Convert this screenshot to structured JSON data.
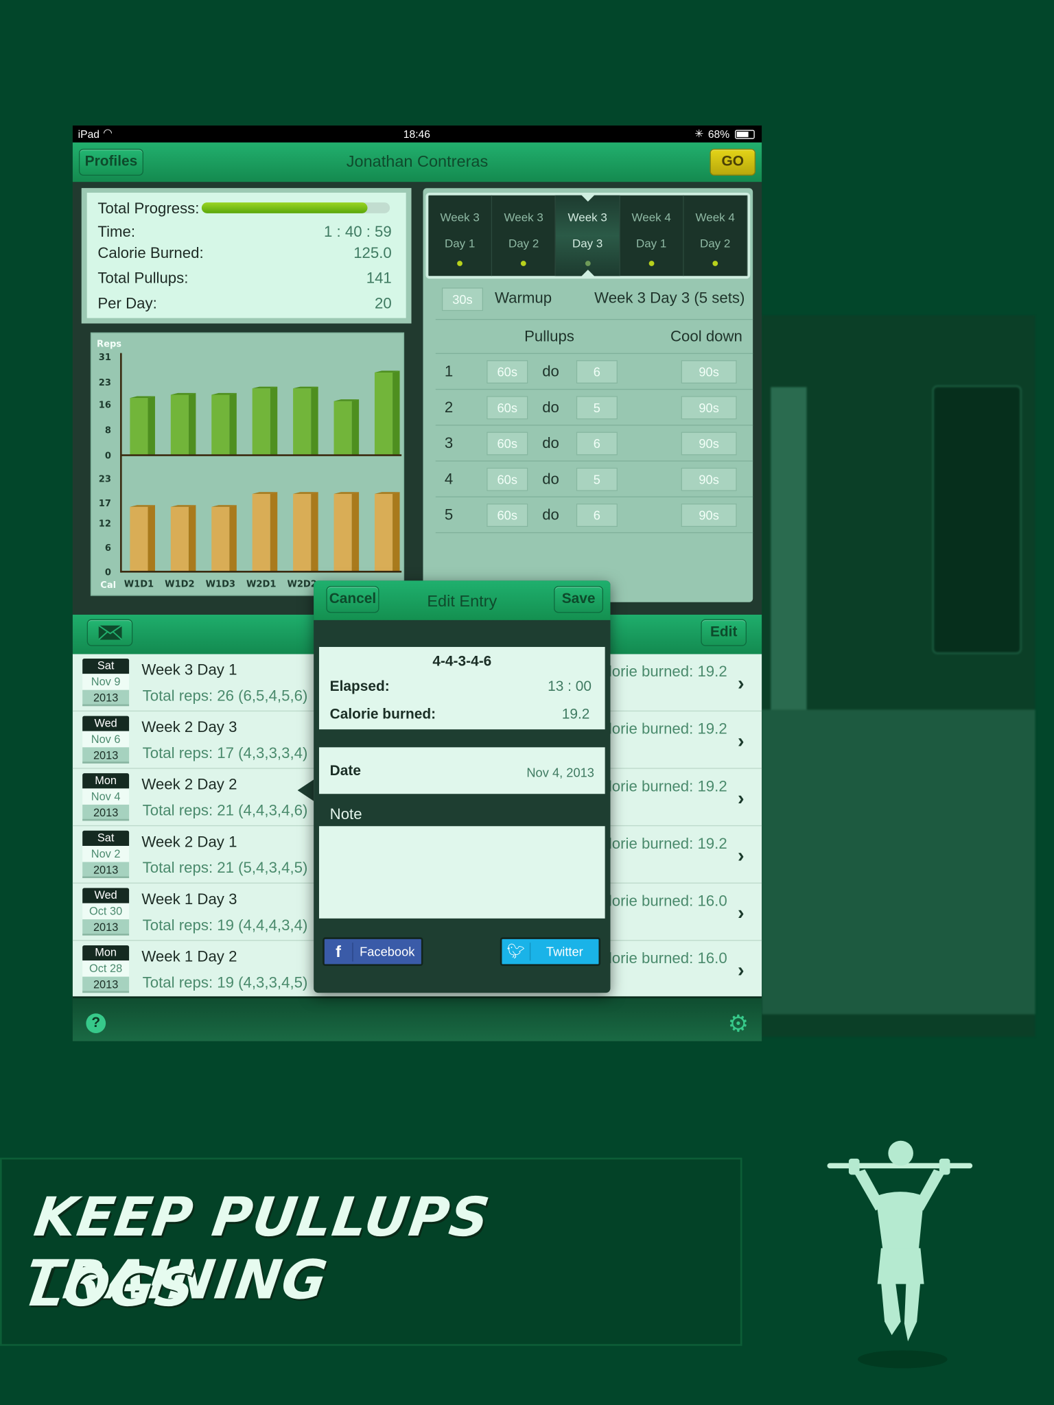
{
  "status_bar": {
    "device": "iPad",
    "time": "18:46",
    "battery": "68%"
  },
  "nav": {
    "profiles_label": "Profiles",
    "title": "Jonathan Contreras",
    "go_label": "GO"
  },
  "stats": {
    "progress_label": "Total Progress:",
    "progress_percent": 88,
    "rows": [
      {
        "label": "Time:",
        "value": "1 : 40 : 59"
      },
      {
        "label": "Calorie Burned:",
        "value": "125.0"
      },
      {
        "label": "Total Pullups:",
        "value": "141"
      },
      {
        "label": "Per Day:",
        "value": "20"
      }
    ]
  },
  "chart_data": {
    "type": "bar",
    "categories": [
      "W1D1",
      "W1D2",
      "W1D3",
      "W2D1",
      "W2D2",
      "",
      ""
    ],
    "series": [
      {
        "name": "Reps",
        "values": [
          18,
          19,
          19,
          21,
          21,
          17,
          26
        ],
        "color": "#72b53a",
        "yticks": [
          0,
          8,
          16,
          23,
          31
        ],
        "ylim": [
          0,
          31
        ]
      },
      {
        "name": "Cal",
        "values": [
          16,
          16,
          16,
          19.2,
          19.2,
          19.2,
          19.2
        ],
        "color": "#d9ad56",
        "yticks": [
          0,
          6,
          12,
          17,
          23
        ],
        "ylim": [
          0,
          23
        ]
      }
    ]
  },
  "weeks": [
    {
      "l1": "Week 3",
      "l2": "Day 1"
    },
    {
      "l1": "Week 3",
      "l2": "Day 2"
    },
    {
      "l1": "Week 3",
      "l2": "Day 3",
      "selected": true
    },
    {
      "l1": "Week 4",
      "l2": "Day 1"
    },
    {
      "l1": "Week 4",
      "l2": "Day 2"
    }
  ],
  "workout": {
    "warmup_time": "30s",
    "warmup_label": "Warmup",
    "plan_title": "Week 3 Day 3 (5 sets)",
    "col_pullups": "Pullups",
    "col_cooldown": "Cool down",
    "sets": [
      {
        "n": "1",
        "rest": "60s",
        "do": "do",
        "reps": "6",
        "cool": "90s"
      },
      {
        "n": "2",
        "rest": "60s",
        "do": "do",
        "reps": "5",
        "cool": "90s"
      },
      {
        "n": "3",
        "rest": "60s",
        "do": "do",
        "reps": "6",
        "cool": "90s"
      },
      {
        "n": "4",
        "rest": "60s",
        "do": "do",
        "reps": "5",
        "cool": "90s"
      },
      {
        "n": "5",
        "rest": "60s",
        "do": "do",
        "reps": "6",
        "cool": "90s"
      }
    ]
  },
  "toolbar": {
    "edit_label": "Edit"
  },
  "log": [
    {
      "dow": "Sat",
      "md": "Nov 9",
      "year": "2013",
      "title": "Week 3 Day 1",
      "reps": "Total reps: 26 (6,5,4,5,6)",
      "cal": "lorie burned: 19.2"
    },
    {
      "dow": "Wed",
      "md": "Nov 6",
      "year": "2013",
      "title": "Week 2 Day 3",
      "reps": "Total reps: 17 (4,3,3,3,4)",
      "cal": "lorie burned: 19.2"
    },
    {
      "dow": "Mon",
      "md": "Nov 4",
      "year": "2013",
      "title": "Week 2 Day 2",
      "reps": "Total reps: 21 (4,4,3,4,6)",
      "cal": "lorie burned: 19.2"
    },
    {
      "dow": "Sat",
      "md": "Nov 2",
      "year": "2013",
      "title": "Week 2 Day 1",
      "reps": "Total reps: 21 (5,4,3,4,5)",
      "cal": "lorie burned: 19.2"
    },
    {
      "dow": "Wed",
      "md": "Oct 30",
      "year": "2013",
      "title": "Week 1 Day 3",
      "reps": "Total reps: 19 (4,4,4,3,4)",
      "cal": "lorie burned: 16.0"
    },
    {
      "dow": "Mon",
      "md": "Oct 28",
      "year": "2013",
      "title": "Week 1 Day 2",
      "reps": "Total reps: 19 (4,3,3,4,5)",
      "cal": "lorie burned: 16.0"
    }
  ],
  "popup": {
    "cancel_label": "Cancel",
    "title": "Edit Entry",
    "save_label": "Save",
    "sets": "4-4-3-4-6",
    "elapsed_label": "Elapsed:",
    "elapsed_value": "13 : 00",
    "calorie_label": "Calorie burned:",
    "calorie_value": "19.2",
    "date_label": "Date",
    "date_value": "Nov 4, 2013",
    "note_label": "Note",
    "note_value": "",
    "facebook_label": "Facebook",
    "twitter_label": "Twitter"
  },
  "banner": {
    "line1": "KEEP PULLUPS TRAINING",
    "line2": "LOGS"
  },
  "colors": {
    "background": "#02462a",
    "accent": "#1fae6c",
    "go": "#d4c414",
    "facebook": "#3a5ba8",
    "twitter": "#1ab3e8"
  }
}
